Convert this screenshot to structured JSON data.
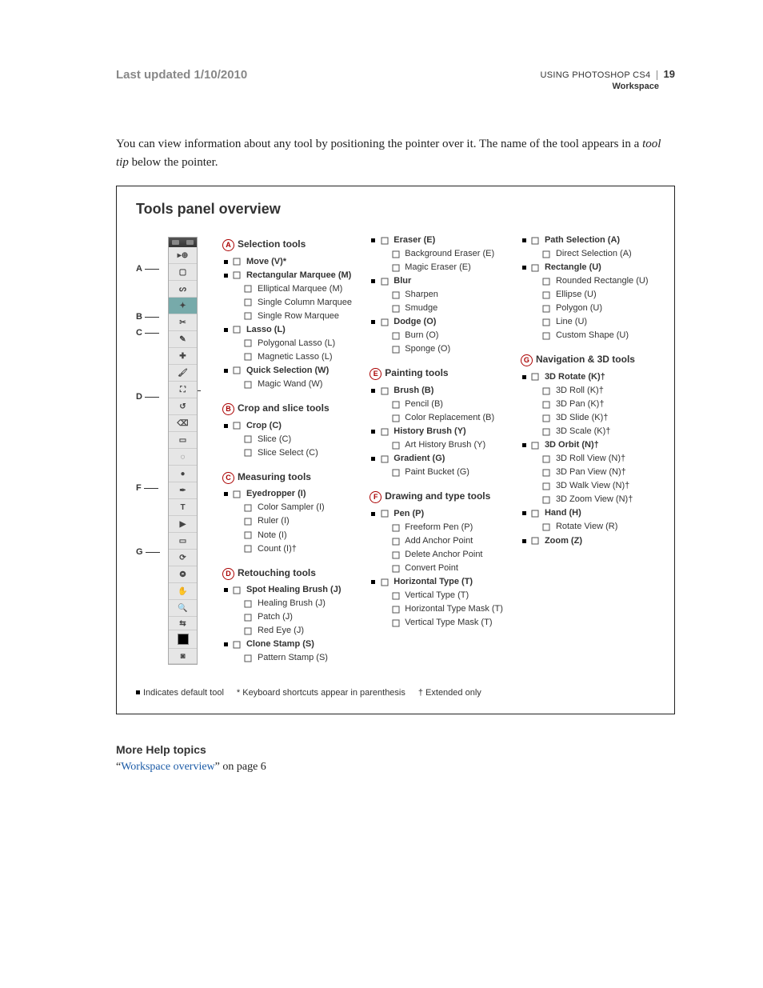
{
  "header": {
    "last_updated": "Last updated 1/10/2010",
    "doc_title": "USING PHOTOSHOP CS4",
    "section": "Workspace",
    "page_num": "19"
  },
  "intro": {
    "p1a": "You can view information about any tool by positioning the pointer over it. The name of the tool appears in a ",
    "p1em": "tool tip",
    "p1b": " below the pointer."
  },
  "panel": {
    "title": "Tools panel overview",
    "callouts": {
      "A": "A",
      "B": "B",
      "C": "C",
      "D": "D",
      "E": "E",
      "F": "F",
      "G": "G"
    },
    "legend": {
      "default": "Indicates default tool",
      "shortcut": "* Keyboard shortcuts appear in parenthesis",
      "extended": "† Extended only"
    },
    "groups": {
      "A": {
        "letter": "A",
        "title": "Selection tools",
        "tools": [
          {
            "d": true,
            "n": "Move  (V)*",
            "icon": "move"
          },
          {
            "d": true,
            "n": "Rectangular Marquee  (M)",
            "icon": "rect-marquee"
          },
          {
            "d": false,
            "n": "Elliptical Marquee  (M)",
            "icon": "ellipse-marquee"
          },
          {
            "d": false,
            "n": "Single Column Marquee",
            "icon": "col-marquee"
          },
          {
            "d": false,
            "n": "Single Row Marquee",
            "icon": "row-marquee"
          },
          {
            "d": true,
            "n": "Lasso  (L)",
            "icon": "lasso"
          },
          {
            "d": false,
            "n": "Polygonal Lasso  (L)",
            "icon": "poly-lasso"
          },
          {
            "d": false,
            "n": "Magnetic Lasso  (L)",
            "icon": "mag-lasso"
          },
          {
            "d": true,
            "n": "Quick Selection (W)",
            "icon": "quick-sel"
          },
          {
            "d": false,
            "n": "Magic Wand  (W)",
            "icon": "wand"
          }
        ]
      },
      "B": {
        "letter": "B",
        "title": "Crop and slice tools",
        "tools": [
          {
            "d": true,
            "n": "Crop  (C)",
            "icon": "crop"
          },
          {
            "d": false,
            "n": "Slice  (C)",
            "icon": "slice"
          },
          {
            "d": false,
            "n": "Slice Select  (C)",
            "icon": "slice-select"
          }
        ]
      },
      "C": {
        "letter": "C",
        "title": "Measuring tools",
        "tools": [
          {
            "d": true,
            "n": "Eyedropper  (I)",
            "icon": "eyedropper"
          },
          {
            "d": false,
            "n": "Color Sampler  (I)",
            "icon": "color-sampler"
          },
          {
            "d": false,
            "n": "Ruler  (I)",
            "icon": "ruler"
          },
          {
            "d": false,
            "n": "Note  (I)",
            "icon": "note"
          },
          {
            "d": false,
            "n": "Count  (I)†",
            "icon": "count"
          }
        ]
      },
      "D": {
        "letter": "D",
        "title": "Retouching tools",
        "tools": [
          {
            "d": true,
            "n": "Spot Healing Brush  (J)",
            "icon": "spot-heal"
          },
          {
            "d": false,
            "n": "Healing Brush  (J)",
            "icon": "heal"
          },
          {
            "d": false,
            "n": "Patch  (J)",
            "icon": "patch"
          },
          {
            "d": false,
            "n": "Red Eye  (J)",
            "icon": "red-eye"
          },
          {
            "d": true,
            "n": "Clone Stamp  (S)",
            "icon": "clone"
          },
          {
            "d": false,
            "n": "Pattern Stamp  (S)",
            "icon": "pattern-stamp"
          },
          {
            "d": true,
            "n": "Eraser  (E)",
            "icon": "eraser"
          },
          {
            "d": false,
            "n": "Background Eraser  (E)",
            "icon": "bg-eraser"
          },
          {
            "d": false,
            "n": "Magic Eraser  (E)",
            "icon": "magic-eraser"
          },
          {
            "d": true,
            "n": "Blur",
            "icon": "blur"
          },
          {
            "d": false,
            "n": "Sharpen",
            "icon": "sharpen"
          },
          {
            "d": false,
            "n": "Smudge",
            "icon": "smudge"
          },
          {
            "d": true,
            "n": "Dodge  (O)",
            "icon": "dodge"
          },
          {
            "d": false,
            "n": "Burn  (O)",
            "icon": "burn"
          },
          {
            "d": false,
            "n": "Sponge  (O)",
            "icon": "sponge"
          }
        ]
      },
      "E": {
        "letter": "E",
        "title": "Painting tools",
        "tools": [
          {
            "d": true,
            "n": "Brush  (B)",
            "icon": "brush"
          },
          {
            "d": false,
            "n": "Pencil  (B)",
            "icon": "pencil"
          },
          {
            "d": false,
            "n": "Color Replacement  (B)",
            "icon": "color-replace"
          },
          {
            "d": true,
            "n": "History Brush  (Y)",
            "icon": "history-brush"
          },
          {
            "d": false,
            "n": "Art History Brush  (Y)",
            "icon": "art-history"
          },
          {
            "d": true,
            "n": "Gradient  (G)",
            "icon": "gradient"
          },
          {
            "d": false,
            "n": "Paint Bucket  (G)",
            "icon": "bucket"
          }
        ]
      },
      "F": {
        "letter": "F",
        "title": "Drawing and type tools",
        "tools": [
          {
            "d": true,
            "n": "Pen  (P)",
            "icon": "pen"
          },
          {
            "d": false,
            "n": "Freeform Pen  (P)",
            "icon": "freeform-pen"
          },
          {
            "d": false,
            "n": "Add Anchor Point",
            "icon": "add-anchor"
          },
          {
            "d": false,
            "n": "Delete Anchor  Point",
            "icon": "del-anchor"
          },
          {
            "d": false,
            "n": "Convert Point",
            "icon": "convert-point"
          },
          {
            "d": true,
            "n": "Horizontal Type  (T)",
            "icon": "h-type"
          },
          {
            "d": false,
            "n": "Vertical Type  (T)",
            "icon": "v-type"
          },
          {
            "d": false,
            "n": "Horizontal Type Mask  (T)",
            "icon": "h-type-mask"
          },
          {
            "d": false,
            "n": "Vertical Type Mask  (T)",
            "icon": "v-type-mask"
          },
          {
            "d": true,
            "n": "Path Selection  (A)",
            "icon": "path-sel"
          },
          {
            "d": false,
            "n": "Direct Selection  (A)",
            "icon": "direct-sel"
          },
          {
            "d": true,
            "n": "Rectangle  (U)",
            "icon": "rect"
          },
          {
            "d": false,
            "n": "Rounded Rectangle  (U)",
            "icon": "round-rect"
          },
          {
            "d": false,
            "n": "Ellipse  (U)",
            "icon": "ellipse"
          },
          {
            "d": false,
            "n": "Polygon  (U)",
            "icon": "polygon"
          },
          {
            "d": false,
            "n": "Line  (U)",
            "icon": "line"
          },
          {
            "d": false,
            "n": "Custom Shape  (U)",
            "icon": "custom-shape"
          }
        ]
      },
      "G": {
        "letter": "G",
        "title": "Navigation & 3D tools",
        "tools": [
          {
            "d": true,
            "n": "3D Rotate  (K)†",
            "icon": "3d-rotate"
          },
          {
            "d": false,
            "n": "3D Roll  (K)†",
            "icon": "3d-roll"
          },
          {
            "d": false,
            "n": "3D Pan  (K)†",
            "icon": "3d-pan"
          },
          {
            "d": false,
            "n": "3D Slide  (K)†",
            "icon": "3d-slide"
          },
          {
            "d": false,
            "n": "3D Scale  (K)†",
            "icon": "3d-scale"
          },
          {
            "d": true,
            "n": "3D Orbit  (N)†",
            "icon": "3d-orbit"
          },
          {
            "d": false,
            "n": "3D Roll View (N)†",
            "icon": "3d-roll-view"
          },
          {
            "d": false,
            "n": "3D Pan View (N)†",
            "icon": "3d-pan-view"
          },
          {
            "d": false,
            "n": "3D Walk View  (N)†",
            "icon": "3d-walk"
          },
          {
            "d": false,
            "n": "3D Zoom View  (N)†",
            "icon": "3d-zoom"
          },
          {
            "d": true,
            "n": "Hand  (H)",
            "icon": "hand"
          },
          {
            "d": false,
            "n": "Rotate View  (R)",
            "icon": "rotate-view"
          },
          {
            "d": true,
            "n": "Zoom  (Z)",
            "icon": "zoom"
          }
        ]
      }
    }
  },
  "more_help": {
    "heading": "More Help topics",
    "link_text": "Workspace overview",
    "link_suffix": " on page 6",
    "quote_l": "“",
    "quote_r": "”"
  }
}
